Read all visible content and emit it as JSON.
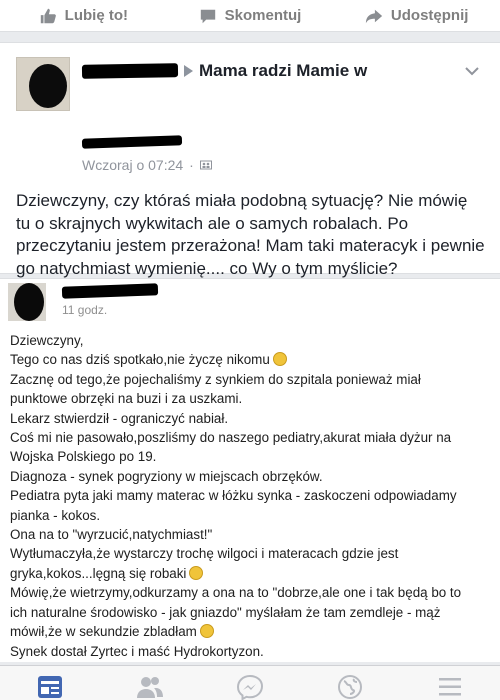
{
  "actions": {
    "like": "Lubię to!",
    "comment": "Skomentuj",
    "share": "Udostępnij"
  },
  "post": {
    "group_name": "Mama radzi Mamie w",
    "timestamp": "Wczoraj o 07:24",
    "separator": "·",
    "text": "Dziewczyny, czy któraś miała podobną sytuację? Nie mówię tu o skrajnych wykwitach ale o samych robalach. Po przeczytaniu jestem przerażona! Mam taki materacyk i pewnie go natychmiast wymienię.... co Wy o tym myślicie?"
  },
  "screenshot": {
    "time": "11 godz.",
    "lines": [
      "Dziewczyny,",
      "Tego co nas dziś spotkało,nie życzę nikomu",
      "Zacznę od tego,że pojechaliśmy z synkiem do szpitala ponieważ miał",
      "punktowe obrzęki na buzi i za uszkami.",
      "Lekarz stwierdził - ograniczyć nabiał.",
      "Coś mi nie pasowało,poszliśmy do naszego pediatry,akurat miała dyżur na",
      "Wojska Polskiego po 19.",
      "Diagnoza - synek pogryziony w miejscach obrzęków.",
      "Pediatra pyta jaki mamy materac w łóżku synka - zaskoczeni odpowiadamy",
      "pianka - kokos.",
      "Ona na to \"wyrzucić,natychmiast!\"",
      "Wytłumaczyła,że wystarczy trochę wilgoci i materacach gdzie jest",
      "gryka,kokos...lęgną się robaki",
      "Mówię,że wietrzymy,odkurzamy a ona na to \"dobrze,ale one i tak będą bo to",
      "ich naturalne środowisko - jak gniazdo\" myślałam że tam zemdleje - mąż",
      "mówił,że w sekundzie zbladłam",
      "Synek dostał Zyrtec i maść Hydrokortyzon."
    ],
    "emoji_lines": [
      1,
      12,
      15
    ]
  },
  "tabs": [
    "news-feed",
    "friend-requests",
    "messenger",
    "notifications",
    "menu"
  ],
  "colors": {
    "active_tab": "#4267b2",
    "inactive_tab": "#b7bac0"
  }
}
